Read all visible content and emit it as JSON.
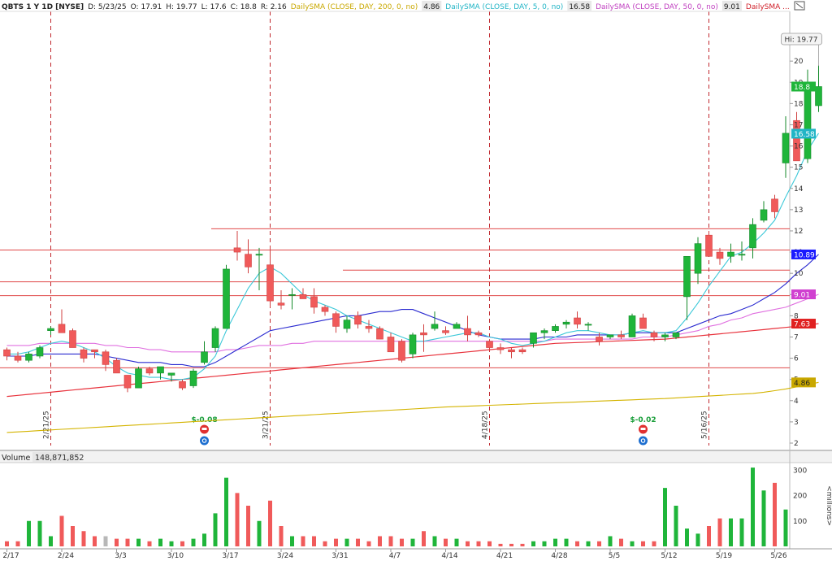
{
  "chart_data": {
    "type": "candlestick",
    "header": {
      "symbol": "QBTS 1 Y 1D [NYSE]",
      "date": "D: 5/23/25",
      "open": "O: 17.91",
      "high": "H: 19.77",
      "low": "L: 17.6",
      "close": "C: 18.8",
      "range": "R: 2.16",
      "studies": [
        {
          "label": "DailySMA (CLOSE, DAY, 200, 0, no)",
          "value": "4.86",
          "color": "#c9a800"
        },
        {
          "label": "DailySMA (CLOSE, DAY, 5, 0, no)",
          "value": "16.58",
          "color": "#22b5c6"
        },
        {
          "label": "DailySMA (CLOSE, DAY, 50, 0, no)",
          "value": "9.01",
          "color": "#c040c0"
        },
        {
          "label": "DailySMA ...",
          "value": "",
          "color": "#d0202a"
        }
      ]
    },
    "x_labels": [
      "2/17",
      "2/24",
      "3/3",
      "3/10",
      "3/17",
      "3/24",
      "3/31",
      "4/7",
      "4/14",
      "4/21",
      "4/28",
      "5/5",
      "5/12",
      "5/19",
      "5/26"
    ],
    "x_label_index": [
      0,
      5,
      10,
      15,
      20,
      25,
      30,
      35,
      40,
      45,
      50,
      55,
      60,
      65,
      70
    ],
    "price_ticks": [
      2,
      3,
      4,
      5,
      6,
      7,
      8,
      9,
      10,
      11,
      12,
      13,
      14,
      15,
      16,
      17,
      18,
      19,
      20,
      21
    ],
    "price_ylim": [
      2,
      21.5
    ],
    "volume_ticks": [
      "100",
      "200",
      "300"
    ],
    "volume_ylim": [
      0,
      320
    ],
    "volume_label": "Volume",
    "volume_value": "148,871,852",
    "volume_axis_label": "<millions>",
    "hi_label": "Hi: 19.77",
    "last_price": {
      "text": "18.8",
      "value": 18.8
    },
    "price_tags": [
      {
        "text": "16.58",
        "value": 16.58,
        "color": "#22b5c6"
      },
      {
        "text": "10.89",
        "value": 10.89,
        "color": "#1a1aff"
      },
      {
        "text": "9.01",
        "value": 9.01,
        "color": "#d040d0"
      },
      {
        "text": "7.63",
        "value": 7.63,
        "color": "#e02020"
      },
      {
        "text": "4.86",
        "value": 4.86,
        "color": "#c9a800"
      }
    ],
    "event_lines": [
      {
        "index": 4,
        "label": "2/21/25"
      },
      {
        "index": 24,
        "label": "3/21/25"
      },
      {
        "index": 44,
        "label": "4/18/25"
      },
      {
        "index": 64,
        "label": "5/16/25"
      }
    ],
    "earnings": [
      {
        "index": 18,
        "label": "$-0.08"
      },
      {
        "index": 58,
        "label": "$-0.02"
      }
    ],
    "horizontal_lines": [
      {
        "value": 12.1,
        "from_index": 19
      },
      {
        "value": 11.1,
        "from_index": -1
      },
      {
        "value": 10.15,
        "from_index": 31
      },
      {
        "value": 9.6,
        "from_index": -1
      },
      {
        "value": 8.95,
        "from_index": -1
      },
      {
        "value": 5.55,
        "from_index": -1
      }
    ],
    "candles": [
      [
        6.4,
        6.5,
        5.9,
        6.1
      ],
      [
        6.1,
        6.3,
        5.8,
        5.9
      ],
      [
        5.9,
        6.3,
        5.8,
        6.2
      ],
      [
        6.1,
        6.6,
        6.0,
        6.5
      ],
      [
        7.3,
        7.5,
        7.1,
        7.4
      ],
      [
        7.6,
        8.3,
        7.3,
        7.2
      ],
      [
        7.3,
        7.4,
        6.6,
        6.5
      ],
      [
        6.4,
        6.5,
        5.8,
        6.0
      ],
      [
        6.4,
        6.4,
        6.0,
        6.3
      ],
      [
        6.3,
        6.4,
        5.4,
        5.7
      ],
      [
        5.9,
        6.0,
        5.4,
        5.3
      ],
      [
        5.2,
        5.2,
        4.4,
        4.6
      ],
      [
        4.6,
        5.6,
        4.6,
        5.5
      ],
      [
        5.5,
        5.6,
        5.2,
        5.3
      ],
      [
        5.3,
        5.6,
        5.0,
        5.6
      ],
      [
        5.2,
        5.3,
        4.9,
        5.3
      ],
      [
        4.9,
        5.0,
        4.5,
        4.6
      ],
      [
        4.7,
        5.5,
        4.6,
        5.4
      ],
      [
        5.8,
        6.8,
        5.7,
        6.3
      ],
      [
        6.5,
        7.5,
        6.3,
        7.4
      ],
      [
        7.4,
        10.4,
        7.4,
        10.2
      ],
      [
        11.2,
        12.0,
        10.6,
        11.0
      ],
      [
        10.9,
        11.6,
        10.0,
        10.3
      ],
      [
        10.9,
        11.2,
        9.2,
        10.9
      ],
      [
        10.4,
        11.3,
        8.4,
        8.7
      ],
      [
        8.6,
        9.2,
        8.3,
        8.5
      ],
      [
        9.0,
        9.3,
        8.3,
        9.0
      ],
      [
        9.0,
        9.3,
        8.8,
        8.8
      ],
      [
        8.9,
        9.3,
        8.1,
        8.4
      ],
      [
        8.4,
        8.5,
        8.0,
        8.2
      ],
      [
        8.1,
        8.2,
        7.2,
        7.5
      ],
      [
        7.4,
        8.0,
        7.2,
        7.8
      ],
      [
        8.0,
        8.2,
        7.4,
        7.6
      ],
      [
        7.5,
        7.8,
        7.2,
        7.4
      ],
      [
        7.4,
        7.5,
        6.9,
        6.9
      ],
      [
        7.0,
        7.2,
        6.3,
        6.3
      ],
      [
        6.8,
        6.9,
        5.8,
        5.9
      ],
      [
        6.2,
        7.2,
        6.0,
        7.1
      ],
      [
        7.2,
        7.6,
        6.3,
        7.1
      ],
      [
        7.4,
        8.2,
        7.3,
        7.6
      ],
      [
        7.3,
        7.5,
        7.1,
        7.2
      ],
      [
        7.4,
        7.7,
        7.4,
        7.6
      ],
      [
        7.4,
        8.0,
        6.8,
        7.1
      ],
      [
        7.2,
        7.3,
        7.0,
        7.1
      ],
      [
        6.8,
        6.9,
        6.4,
        6.5
      ],
      [
        6.5,
        6.7,
        6.2,
        6.4
      ],
      [
        6.4,
        6.5,
        6.0,
        6.3
      ],
      [
        6.4,
        6.5,
        6.2,
        6.3
      ],
      [
        6.7,
        6.9,
        6.5,
        7.2
      ],
      [
        7.2,
        7.4,
        6.9,
        7.3
      ],
      [
        7.3,
        7.6,
        7.2,
        7.5
      ],
      [
        7.6,
        7.8,
        7.4,
        7.7
      ],
      [
        7.9,
        8.2,
        7.4,
        7.6
      ],
      [
        7.6,
        7.7,
        7.3,
        7.6
      ],
      [
        7.0,
        7.2,
        6.6,
        6.8
      ],
      [
        7.0,
        7.1,
        6.9,
        7.1
      ],
      [
        7.1,
        7.3,
        6.9,
        7.0
      ],
      [
        7.0,
        8.1,
        7.2,
        8.0
      ],
      [
        7.9,
        8.1,
        7.4,
        7.4
      ],
      [
        7.2,
        7.3,
        6.8,
        7.0
      ],
      [
        7.0,
        7.2,
        6.8,
        7.1
      ],
      [
        7.0,
        7.2,
        6.9,
        7.2
      ],
      [
        8.9,
        10.6,
        7.8,
        10.8
      ],
      [
        10.0,
        11.7,
        9.5,
        11.4
      ],
      [
        11.8,
        12.0,
        10.8,
        10.8
      ],
      [
        11.0,
        11.2,
        10.4,
        10.7
      ],
      [
        10.8,
        11.4,
        10.5,
        11.0
      ],
      [
        10.9,
        11.5,
        10.6,
        10.9
      ],
      [
        11.2,
        12.6,
        10.7,
        12.3
      ],
      [
        12.5,
        13.4,
        12.4,
        13.0
      ],
      [
        13.5,
        13.7,
        12.6,
        12.9
      ],
      [
        15.2,
        17.4,
        14.5,
        16.6
      ],
      [
        17.2,
        17.6,
        16.7,
        15.3
      ],
      [
        15.4,
        19.6,
        15.2,
        19.0
      ],
      [
        17.9,
        19.8,
        17.6,
        18.8
      ]
    ],
    "sma5": [
      6.2,
      6.2,
      6.3,
      6.5,
      6.7,
      6.8,
      6.7,
      6.5,
      6.3,
      6.0,
      5.6,
      5.3,
      5.2,
      5.1,
      5.1,
      5.0,
      5.0,
      5.1,
      5.5,
      6.1,
      7.3,
      8.3,
      9.3,
      10.0,
      10.3,
      10.0,
      9.5,
      9.0,
      8.7,
      8.5,
      8.3,
      8.0,
      7.8,
      7.6,
      7.4,
      7.2,
      7.0,
      6.8,
      6.8,
      6.9,
      7.0,
      7.1,
      7.2,
      7.2,
      7.0,
      6.9,
      6.7,
      6.6,
      6.7,
      6.8,
      7.0,
      7.2,
      7.3,
      7.3,
      7.2,
      7.1,
      7.1,
      7.2,
      7.3,
      7.2,
      7.2,
      7.3,
      7.9,
      8.6,
      9.4,
      10.1,
      10.8,
      11.0,
      11.4,
      11.9,
      12.5,
      13.6,
      14.6,
      15.8,
      16.6
    ],
    "sma50": [
      6.6,
      6.6,
      6.6,
      6.7,
      6.7,
      6.7,
      6.7,
      6.7,
      6.7,
      6.6,
      6.6,
      6.5,
      6.5,
      6.4,
      6.4,
      6.3,
      6.3,
      6.3,
      6.3,
      6.3,
      6.4,
      6.4,
      6.5,
      6.6,
      6.6,
      6.6,
      6.7,
      6.7,
      6.8,
      6.8,
      6.8,
      6.8,
      6.8,
      6.8,
      6.8,
      6.8,
      6.8,
      6.8,
      6.8,
      6.8,
      6.8,
      6.8,
      6.8,
      6.8,
      6.8,
      6.8,
      6.8,
      6.8,
      6.8,
      6.8,
      6.9,
      6.9,
      6.9,
      6.9,
      6.9,
      6.9,
      6.9,
      6.9,
      7.0,
      7.0,
      7.0,
      7.1,
      7.2,
      7.3,
      7.5,
      7.6,
      7.8,
      7.9,
      8.1,
      8.2,
      8.3,
      8.4,
      8.6,
      8.8,
      9.01
    ],
    "sma20": [
      6.1,
      6.1,
      6.1,
      6.2,
      6.2,
      6.2,
      6.2,
      6.2,
      6.2,
      6.1,
      6.0,
      5.9,
      5.8,
      5.8,
      5.8,
      5.7,
      5.7,
      5.6,
      5.6,
      5.8,
      6.1,
      6.4,
      6.7,
      7.0,
      7.3,
      7.4,
      7.5,
      7.6,
      7.7,
      7.8,
      7.9,
      8.0,
      8.0,
      8.1,
      8.2,
      8.2,
      8.3,
      8.3,
      8.1,
      7.9,
      7.7,
      7.5,
      7.3,
      7.1,
      7.0,
      6.9,
      6.9,
      6.9,
      6.9,
      7.0,
      7.0,
      7.0,
      7.1,
      7.1,
      7.1,
      7.1,
      7.1,
      7.2,
      7.2,
      7.2,
      7.2,
      7.2,
      7.4,
      7.6,
      7.8,
      8.0,
      8.1,
      8.3,
      8.5,
      8.8,
      9.1,
      9.5,
      10.0,
      10.4,
      10.89
    ],
    "sma100": [
      4.2,
      4.25,
      4.3,
      4.35,
      4.4,
      4.45,
      4.5,
      4.55,
      4.6,
      4.65,
      4.7,
      4.75,
      4.8,
      4.85,
      4.9,
      4.95,
      5.0,
      5.05,
      5.1,
      5.15,
      5.2,
      5.25,
      5.3,
      5.35,
      5.4,
      5.45,
      5.5,
      5.55,
      5.6,
      5.65,
      5.7,
      5.75,
      5.8,
      5.85,
      5.9,
      5.95,
      6.0,
      6.05,
      6.1,
      6.15,
      6.2,
      6.25,
      6.3,
      6.35,
      6.4,
      6.45,
      6.5,
      6.55,
      6.6,
      6.65,
      6.7,
      6.72,
      6.74,
      6.76,
      6.78,
      6.8,
      6.82,
      6.84,
      6.86,
      6.88,
      6.9,
      6.95,
      7.0,
      7.05,
      7.1,
      7.15,
      7.2,
      7.25,
      7.3,
      7.35,
      7.4,
      7.45,
      7.5,
      7.55,
      7.63
    ],
    "sma200": [
      2.5,
      2.53,
      2.56,
      2.59,
      2.62,
      2.65,
      2.68,
      2.71,
      2.74,
      2.77,
      2.8,
      2.83,
      2.86,
      2.89,
      2.92,
      2.95,
      2.98,
      3.01,
      3.04,
      3.07,
      3.1,
      3.13,
      3.16,
      3.19,
      3.22,
      3.25,
      3.28,
      3.31,
      3.34,
      3.37,
      3.4,
      3.43,
      3.46,
      3.49,
      3.52,
      3.55,
      3.58,
      3.61,
      3.64,
      3.67,
      3.7,
      3.72,
      3.74,
      3.76,
      3.78,
      3.8,
      3.82,
      3.84,
      3.86,
      3.88,
      3.9,
      3.92,
      3.94,
      3.96,
      3.98,
      4.0,
      4.02,
      4.04,
      4.06,
      4.08,
      4.1,
      4.13,
      4.16,
      4.19,
      4.22,
      4.25,
      4.28,
      4.31,
      4.34,
      4.4,
      4.47,
      4.55,
      4.65,
      4.75,
      4.86
    ],
    "volume": [
      20,
      20,
      100,
      100,
      40,
      120,
      80,
      60,
      40,
      40,
      30,
      30,
      30,
      20,
      30,
      20,
      20,
      30,
      50,
      130,
      270,
      210,
      160,
      100,
      180,
      80,
      40,
      40,
      40,
      20,
      30,
      30,
      30,
      20,
      40,
      40,
      30,
      30,
      60,
      40,
      30,
      30,
      20,
      20,
      20,
      10,
      10,
      10,
      20,
      20,
      30,
      30,
      20,
      20,
      20,
      40,
      30,
      20,
      20,
      20,
      230,
      160,
      70,
      50,
      80,
      110,
      110,
      110,
      310,
      220,
      250,
      145
    ]
  }
}
